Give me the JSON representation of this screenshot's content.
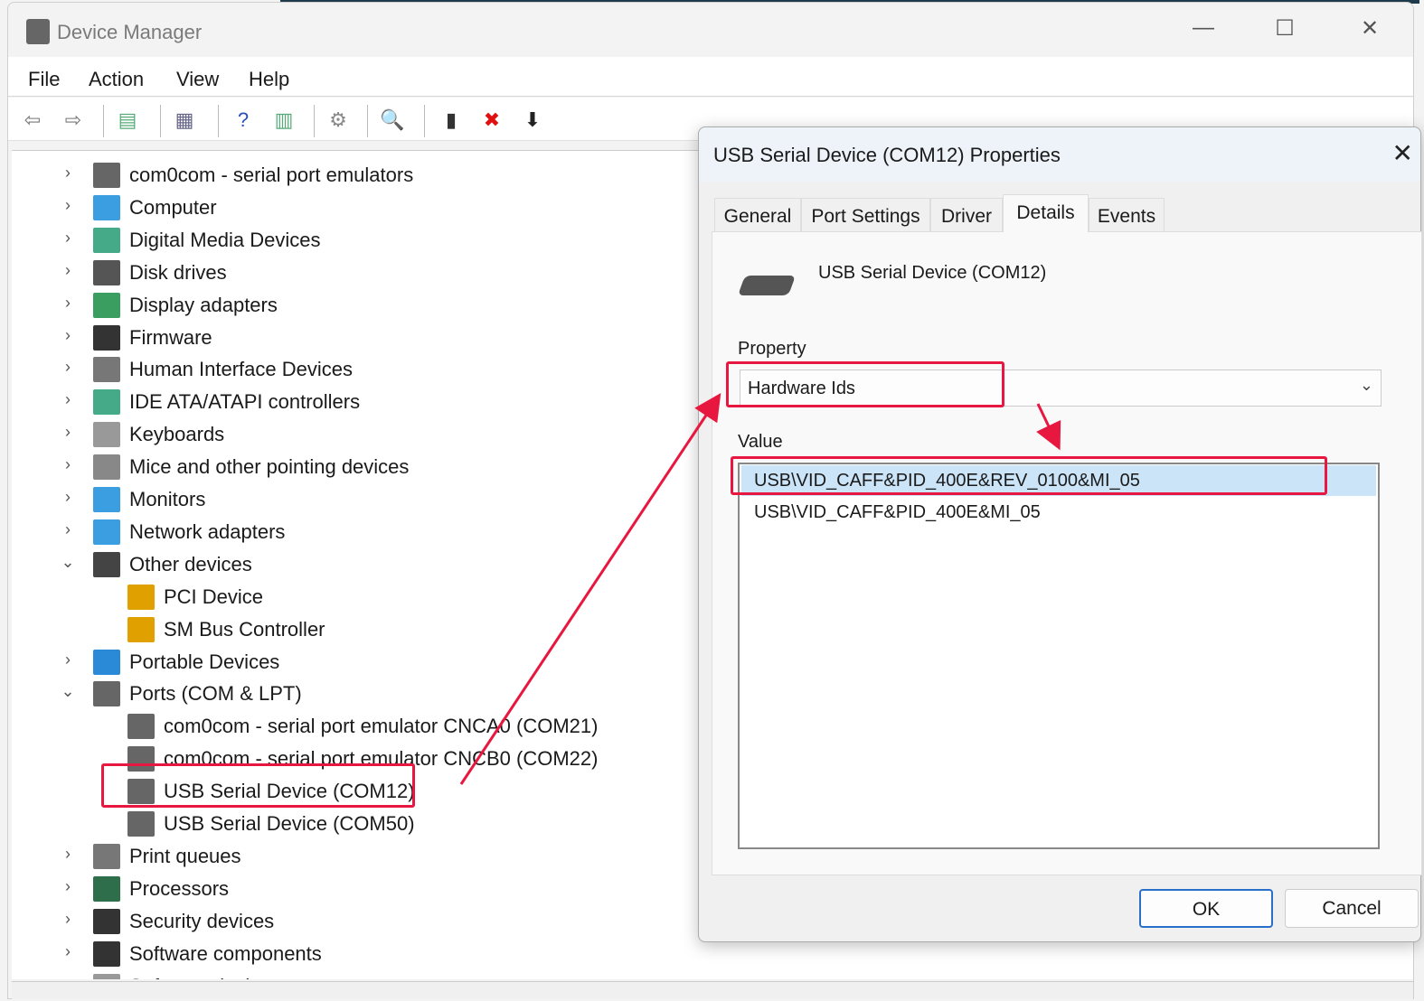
{
  "window": {
    "title": "Device Manager",
    "minimize": "—",
    "maximize": "☐",
    "close": "✕"
  },
  "menu": [
    "File",
    "Action",
    "View",
    "Help"
  ],
  "toolbar": [
    {
      "icon": "back-arrow-icon",
      "glyph": "⇦",
      "color": "#777"
    },
    {
      "icon": "forward-arrow-icon",
      "glyph": "⇨",
      "color": "#777"
    },
    {
      "icon": "show-hide-console-tree-icon",
      "glyph": "▤",
      "color": "#5a7"
    },
    {
      "icon": "properties-icon",
      "glyph": "▦",
      "color": "#668"
    },
    {
      "icon": "help-icon",
      "glyph": "?",
      "color": "#2a4fb5"
    },
    {
      "icon": "show-action-pane-icon",
      "glyph": "▥",
      "color": "#5a7"
    },
    {
      "icon": "update-driver-icon",
      "glyph": "⚙",
      "color": "#888"
    },
    {
      "icon": "scan-hardware-icon",
      "glyph": "🔍",
      "color": "#3a8fd0"
    },
    {
      "icon": "add-legacy-hardware-icon",
      "glyph": "▮",
      "color": "#333"
    },
    {
      "icon": "uninstall-icon",
      "glyph": "✖",
      "color": "#e01010"
    },
    {
      "icon": "download-icon",
      "glyph": "⬇",
      "color": "#222"
    }
  ],
  "tree": [
    {
      "label": "com0com - serial port emulators",
      "level": 0,
      "state": "collapsed",
      "icon": "port-icon",
      "color": "#666"
    },
    {
      "label": "Computer",
      "level": 0,
      "state": "collapsed",
      "icon": "computer-icon",
      "color": "#3a9ee0"
    },
    {
      "label": "Digital Media Devices",
      "level": 0,
      "state": "collapsed",
      "icon": "media-device-icon",
      "color": "#4a8"
    },
    {
      "label": "Disk drives",
      "level": 0,
      "state": "collapsed",
      "icon": "disk-icon",
      "color": "#555"
    },
    {
      "label": "Display adapters",
      "level": 0,
      "state": "collapsed",
      "icon": "display-adapter-icon",
      "color": "#3a9e60"
    },
    {
      "label": "Firmware",
      "level": 0,
      "state": "collapsed",
      "icon": "firmware-icon",
      "color": "#333"
    },
    {
      "label": "Human Interface Devices",
      "level": 0,
      "state": "collapsed",
      "icon": "hid-icon",
      "color": "#777"
    },
    {
      "label": "IDE ATA/ATAPI controllers",
      "level": 0,
      "state": "collapsed",
      "icon": "ide-controller-icon",
      "color": "#4a8"
    },
    {
      "label": "Keyboards",
      "level": 0,
      "state": "collapsed",
      "icon": "keyboard-icon",
      "color": "#999"
    },
    {
      "label": "Mice and other pointing devices",
      "level": 0,
      "state": "collapsed",
      "icon": "mouse-icon",
      "color": "#888"
    },
    {
      "label": "Monitors",
      "level": 0,
      "state": "collapsed",
      "icon": "monitor-icon",
      "color": "#3a9ee0"
    },
    {
      "label": "Network adapters",
      "level": 0,
      "state": "collapsed",
      "icon": "network-adapter-icon",
      "color": "#3a9ee0"
    },
    {
      "label": "Other devices",
      "level": 0,
      "state": "expanded",
      "icon": "unknown-device-icon",
      "color": "#444"
    },
    {
      "label": "PCI Device",
      "level": 1,
      "state": "none",
      "icon": "warning-device-icon",
      "color": "#e0a000"
    },
    {
      "label": "SM Bus Controller",
      "level": 1,
      "state": "none",
      "icon": "warning-device-icon",
      "color": "#e0a000"
    },
    {
      "label": "Portable Devices",
      "level": 0,
      "state": "collapsed",
      "icon": "portable-device-icon",
      "color": "#2a8ad8"
    },
    {
      "label": "Ports (COM & LPT)",
      "level": 0,
      "state": "expanded",
      "icon": "port-icon",
      "color": "#666"
    },
    {
      "label": "com0com - serial port emulator CNCA0 (COM21)",
      "level": 1,
      "state": "none",
      "icon": "port-icon",
      "color": "#666"
    },
    {
      "label": "com0com - serial port emulator CNCB0 (COM22)",
      "level": 1,
      "state": "none",
      "icon": "port-icon",
      "color": "#666"
    },
    {
      "label": "USB Serial Device (COM12)",
      "level": 1,
      "state": "none",
      "icon": "port-icon",
      "color": "#666"
    },
    {
      "label": "USB Serial Device (COM50)",
      "level": 1,
      "state": "none",
      "icon": "port-icon",
      "color": "#666"
    },
    {
      "label": "Print queues",
      "level": 0,
      "state": "collapsed",
      "icon": "printer-icon",
      "color": "#777"
    },
    {
      "label": "Processors",
      "level": 0,
      "state": "collapsed",
      "icon": "processor-icon",
      "color": "#2e6e4a"
    },
    {
      "label": "Security devices",
      "level": 0,
      "state": "collapsed",
      "icon": "security-device-icon",
      "color": "#333"
    },
    {
      "label": "Software components",
      "level": 0,
      "state": "collapsed",
      "icon": "software-component-icon",
      "color": "#333"
    },
    {
      "label": "Software devices",
      "level": 0,
      "state": "collapsed",
      "icon": "software-device-icon",
      "color": "#999"
    }
  ],
  "dialog": {
    "title": "USB Serial Device (COM12) Properties",
    "close": "✕",
    "tabs": [
      "General",
      "Port Settings",
      "Driver",
      "Details",
      "Events"
    ],
    "active_tab": "Details",
    "device_name": "USB Serial Device (COM12)",
    "property_label": "Property",
    "property_value": "Hardware Ids",
    "value_label": "Value",
    "values": [
      "USB\\VID_CAFF&PID_400E&REV_0100&MI_05",
      "USB\\VID_CAFF&PID_400E&MI_05"
    ],
    "selected_value": 0,
    "ok": "OK",
    "cancel": "Cancel"
  },
  "annotation_color": "#e8173f"
}
